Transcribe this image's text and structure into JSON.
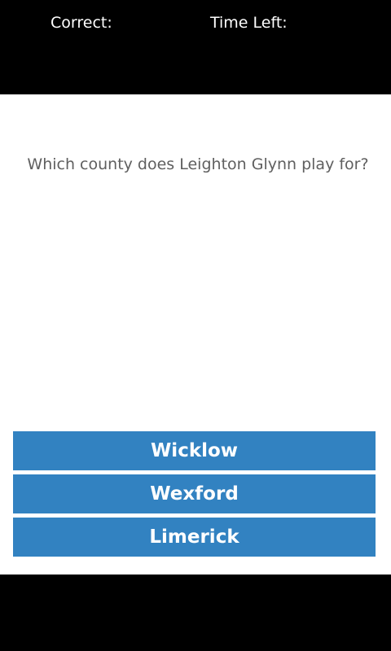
{
  "header": {
    "correct_label": "Correct:",
    "time_left_label": "Time Left:"
  },
  "quiz": {
    "question": "Which county does Leighton Glynn play for?",
    "answers": [
      {
        "label": "Wicklow"
      },
      {
        "label": "Wexford"
      },
      {
        "label": "Limerick"
      }
    ]
  },
  "colors": {
    "header_bg": "#000000",
    "content_bg": "#ffffff",
    "answer_button_bg": "#3282c1",
    "answer_button_text": "#ffffff",
    "question_text": "#5f5f5f"
  }
}
